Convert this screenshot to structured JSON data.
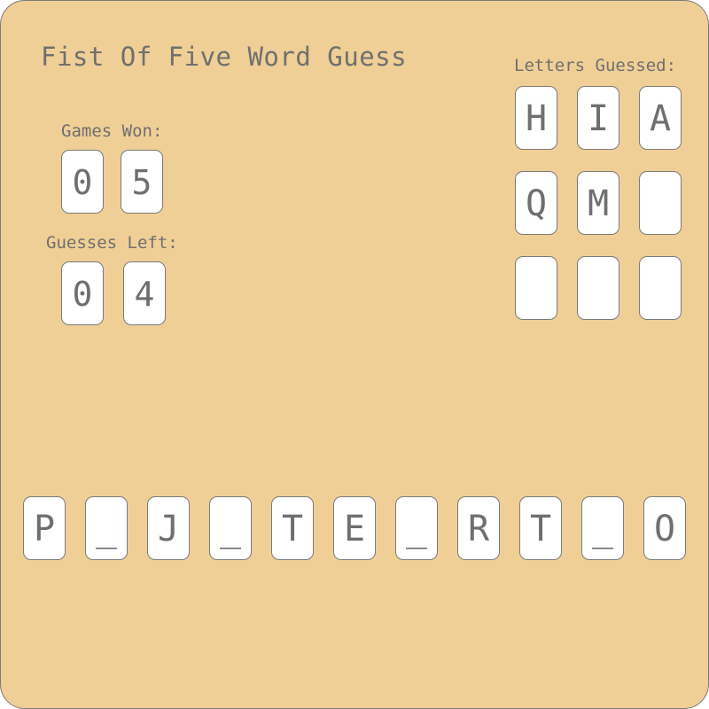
{
  "title": "Fist Of Five Word Guess",
  "games_won": {
    "label": "Games Won:",
    "digits": [
      "0",
      "5"
    ]
  },
  "guesses_left": {
    "label": "Guesses Left:",
    "digits": [
      "0",
      "4"
    ]
  },
  "letters_guessed": {
    "label": "Letters Guessed:",
    "slots": [
      "H",
      "I",
      "A",
      "Q",
      "M",
      "",
      "",
      "",
      ""
    ]
  },
  "word": {
    "letters": [
      "P",
      "_",
      "J",
      "_",
      "T",
      "E",
      "_",
      "R",
      "T",
      "_",
      "O"
    ]
  },
  "colors": {
    "board": "#f0cf96",
    "tile": "#ffffff",
    "text": "#6f6f6f",
    "border": "#7a7a7a"
  }
}
